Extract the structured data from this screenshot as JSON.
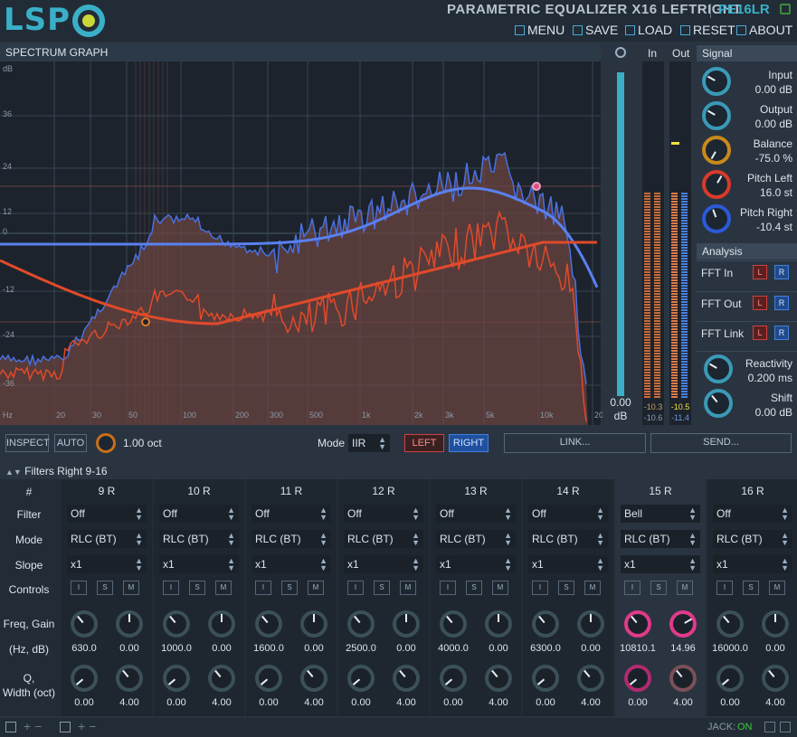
{
  "header": {
    "logo": "LSP",
    "title": "PARAMETRIC EQUALIZER X16 LEFTRIGHT",
    "plugin_id": "PE16LR",
    "menu": [
      {
        "label": "MENU",
        "icon": "menu-icon"
      },
      {
        "label": "SAVE",
        "icon": "save-icon"
      },
      {
        "label": "LOAD",
        "icon": "load-icon"
      },
      {
        "label": "RESET",
        "icon": "reset-icon"
      },
      {
        "label": "ABOUT",
        "icon": "about-icon"
      }
    ]
  },
  "graph": {
    "label": "SPECTRUM GRAPH",
    "y_unit": "dB",
    "y_ticks": [
      "36",
      "24",
      "12",
      "0",
      "-12",
      "-24",
      "-36"
    ],
    "x_unit": "Hz",
    "x_ticks": [
      "20",
      "30",
      "50",
      "100",
      "200",
      "300",
      "500",
      "1k",
      "2k",
      "3k",
      "5k",
      "10k",
      "20k"
    ],
    "colors": {
      "left": "#e04a2a",
      "right": "#4a70e0",
      "fill": "#7a4a44"
    }
  },
  "zoom": {
    "value": "0.00",
    "unit": "dB",
    "level": 0.9
  },
  "meters": {
    "in_label": "In",
    "out_label": "Out",
    "in_peaks": [
      "-10.3",
      "-10.6"
    ],
    "out_peaks": [
      "-10.5",
      "-11.4"
    ]
  },
  "signal": {
    "label": "Signal",
    "knobs": [
      {
        "label": "Input",
        "value": "0.00 dB",
        "color": "#3a9ab8"
      },
      {
        "label": "Output",
        "value": "0.00 dB",
        "color": "#3a9ab8"
      },
      {
        "label": "Balance",
        "value": "-75.0 %",
        "color": "#c88a1a"
      },
      {
        "label": "Pitch Left",
        "value": "16.0 st",
        "color": "#d83a2a"
      },
      {
        "label": "Pitch Right",
        "value": "-10.4 st",
        "color": "#2a5ad8"
      }
    ]
  },
  "analysis": {
    "label": "Analysis",
    "rows": [
      {
        "label": "FFT In",
        "l": "L",
        "r": "R"
      },
      {
        "label": "FFT Out",
        "l": "L",
        "r": "R"
      },
      {
        "label": "FFT Link",
        "l": "L",
        "r": "R"
      }
    ],
    "reactivity": {
      "label": "Reactivity",
      "value": "0.200 ms"
    },
    "shift": {
      "label": "Shift",
      "value": "0.00 dB"
    }
  },
  "toolbar": {
    "inspect": "INSPECT",
    "auto": "AUTO",
    "oct_value": "1.00 oct",
    "mode_label": "Mode",
    "mode_value": "IIR",
    "left": "LEFT",
    "right": "RIGHT",
    "link": "LINK...",
    "send": "SEND..."
  },
  "filters": {
    "header": "Filters Right 9-16",
    "row_labels": {
      "num": "#",
      "filter": "Filter",
      "mode": "Mode",
      "slope": "Slope",
      "controls": "Controls",
      "freq_gain": "Freq, Gain",
      "hz_db": "(Hz, dB)",
      "q": "Q,",
      "width": "Width (oct)"
    },
    "control_buttons": [
      "I",
      "S",
      "M"
    ],
    "bands": [
      {
        "name": "9 R",
        "filter": "Off",
        "mode": "RLC (BT)",
        "slope": "x1",
        "freq": "630.0",
        "gain": "0.00",
        "q": "0.00",
        "width": "4.00",
        "active": false
      },
      {
        "name": "10 R",
        "filter": "Off",
        "mode": "RLC (BT)",
        "slope": "x1",
        "freq": "1000.0",
        "gain": "0.00",
        "q": "0.00",
        "width": "4.00",
        "active": false
      },
      {
        "name": "11 R",
        "filter": "Off",
        "mode": "RLC (BT)",
        "slope": "x1",
        "freq": "1600.0",
        "gain": "0.00",
        "q": "0.00",
        "width": "4.00",
        "active": false
      },
      {
        "name": "12 R",
        "filter": "Off",
        "mode": "RLC (BT)",
        "slope": "x1",
        "freq": "2500.0",
        "gain": "0.00",
        "q": "0.00",
        "width": "4.00",
        "active": false
      },
      {
        "name": "13 R",
        "filter": "Off",
        "mode": "RLC (BT)",
        "slope": "x1",
        "freq": "4000.0",
        "gain": "0.00",
        "q": "0.00",
        "width": "4.00",
        "active": false
      },
      {
        "name": "14 R",
        "filter": "Off",
        "mode": "RLC (BT)",
        "slope": "x1",
        "freq": "6300.0",
        "gain": "0.00",
        "q": "0.00",
        "width": "4.00",
        "active": false
      },
      {
        "name": "15 R",
        "filter": "Bell",
        "mode": "RLC (BT)",
        "slope": "x1",
        "freq": "10810.1",
        "gain": "14.96",
        "q": "0.00",
        "width": "4.00",
        "active": true
      },
      {
        "name": "16 R",
        "filter": "Off",
        "mode": "RLC (BT)",
        "slope": "x1",
        "freq": "16000.0",
        "gain": "0.00",
        "q": "0.00",
        "width": "4.00",
        "active": false
      }
    ]
  },
  "status": {
    "jack_label": "JACK:",
    "jack_value": "ON"
  }
}
